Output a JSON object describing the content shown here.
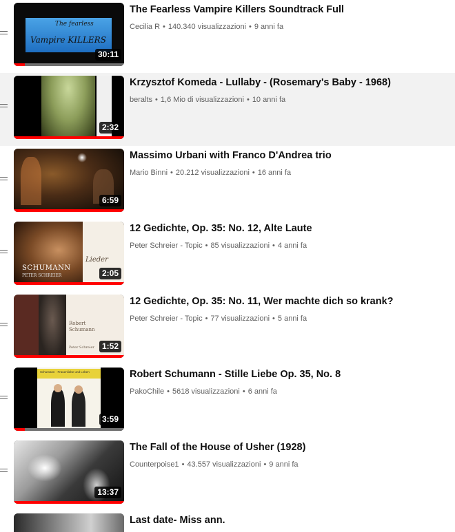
{
  "playlist": {
    "videos": [
      {
        "title": "The Fearless Vampire Killers Soundtrack Full",
        "channel": "Cecilia R",
        "views": "140.340 visualizzazioni",
        "age": "9 anni fa",
        "duration": "30:11",
        "progress": 0.1,
        "thumb_text": [
          "The fearless",
          "Vampire KILLERS"
        ],
        "highlighted": false
      },
      {
        "title": "Krzysztof Komeda - Lullaby - (Rosemary's Baby - 1968)",
        "channel": "beralts",
        "views": "1,6 Mio di visualizzazioni",
        "age": "10 anni fa",
        "duration": "2:32",
        "progress": 1.0,
        "thumb_text": [],
        "highlighted": true
      },
      {
        "title": "Massimo Urbani with Franco D'Andrea trio",
        "channel": "Mario Binni",
        "views": "20.212 visualizzazioni",
        "age": "16 anni fa",
        "duration": "6:59",
        "progress": 1.0,
        "thumb_text": [],
        "highlighted": false
      },
      {
        "title": "12 Gedichte, Op. 35: No. 12, Alte Laute",
        "channel": "Peter Schreier - Topic",
        "views": "85 visualizzazioni",
        "age": "4 anni fa",
        "duration": "2:05",
        "progress": 1.0,
        "thumb_text": [
          "SCHUMANN",
          "PETER SCHREIER",
          "Lieder"
        ],
        "highlighted": false
      },
      {
        "title": "12 Gedichte, Op. 35: No. 11, Wer machte dich so krank?",
        "channel": "Peter Schreier - Topic",
        "views": "77 visualizzazioni",
        "age": "5 anni fa",
        "duration": "1:52",
        "progress": 1.0,
        "thumb_text": [
          "Robert",
          "Schumann",
          "Peter Schreier"
        ],
        "highlighted": false
      },
      {
        "title": "Robert Schumann - Stille Liebe Op. 35, No. 8",
        "channel": "PakoChile",
        "views": "5618 visualizzazioni",
        "age": "6 anni fa",
        "duration": "3:59",
        "progress": 0.1,
        "thumb_text": [
          "Schumann · Frauenliebe und Leben"
        ],
        "highlighted": false
      },
      {
        "title": "The Fall of the House of Usher (1928)",
        "channel": "Counterpoise1",
        "views": "43.557 visualizzazioni",
        "age": "9 anni fa",
        "duration": "13:37",
        "progress": 1.0,
        "thumb_text": [],
        "highlighted": false
      },
      {
        "title": "Last date- Miss ann.",
        "channel": "",
        "views": "",
        "age": "",
        "duration": "",
        "progress": 0,
        "thumb_text": [],
        "highlighted": false
      }
    ]
  },
  "colors": {
    "accent": "#ff0000",
    "meta": "#606060",
    "title": "#0f0f0f",
    "highlight": "#f2f2f2"
  }
}
